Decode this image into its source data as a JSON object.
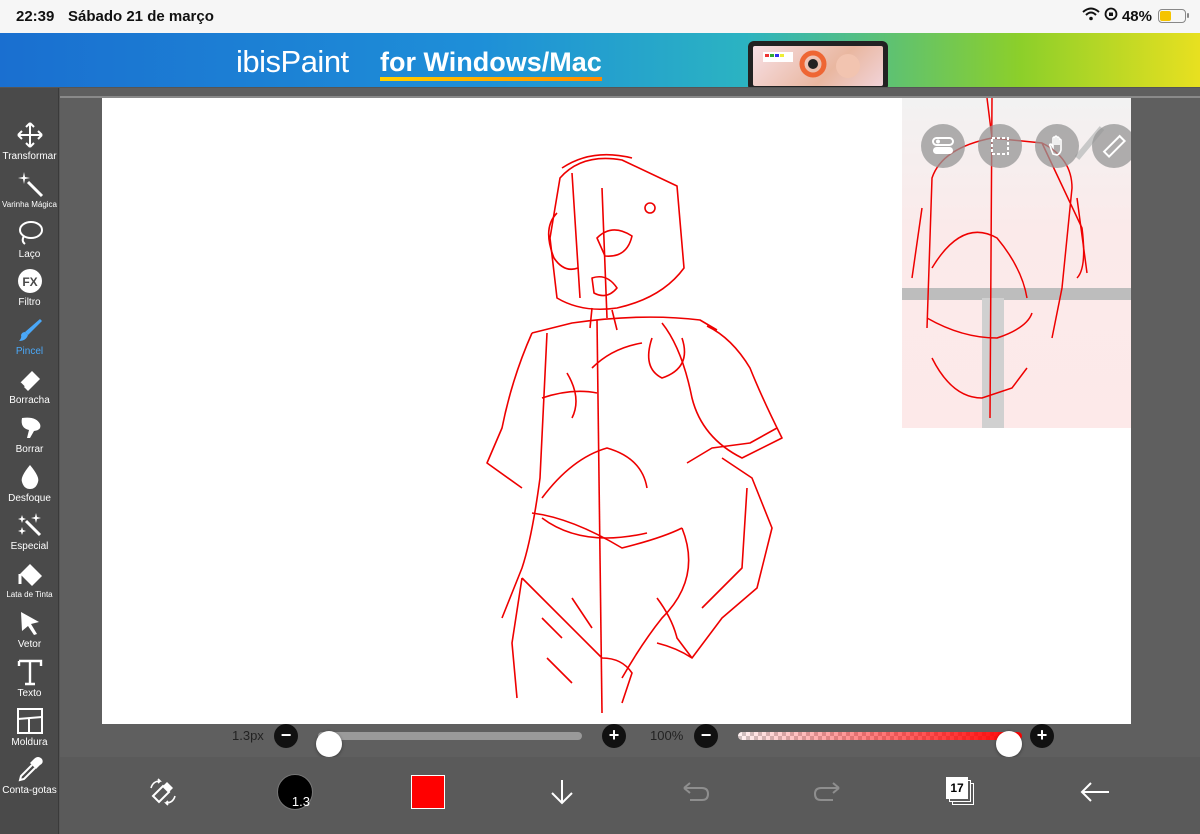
{
  "status_bar": {
    "time": "22:39",
    "date": "Sábado 21 de março",
    "battery": "48%",
    "battery_level": 0.48,
    "icons": [
      "wifi-icon",
      "orientation-lock-icon",
      "battery-icon"
    ]
  },
  "ad_banner": {
    "logo": "ibisPaint",
    "tagline": "for Windows/Mac"
  },
  "tools": [
    {
      "name": "transform",
      "label": "Transformar",
      "icon": "move-arrows-icon"
    },
    {
      "name": "magic-wand",
      "label": "Varinha Mágica",
      "icon": "magic-wand-icon"
    },
    {
      "name": "lasso",
      "label": "Laço",
      "icon": "lasso-icon"
    },
    {
      "name": "filter",
      "label": "Filtro",
      "icon": "fx-icon"
    },
    {
      "name": "brush",
      "label": "Pincel",
      "icon": "brush-icon",
      "active": true
    },
    {
      "name": "eraser",
      "label": "Borracha",
      "icon": "eraser-icon"
    },
    {
      "name": "smudge",
      "label": "Borrar",
      "icon": "smudge-icon"
    },
    {
      "name": "blur",
      "label": "Desfoque",
      "icon": "drop-icon"
    },
    {
      "name": "special",
      "label": "Especial",
      "icon": "sparkle-icon"
    },
    {
      "name": "bucket",
      "label": "Lata de Tinta",
      "icon": "paint-bucket-icon"
    },
    {
      "name": "vector",
      "label": "Vetor",
      "icon": "cursor-arrow-icon"
    },
    {
      "name": "text",
      "label": "Texto",
      "icon": "text-t-icon"
    },
    {
      "name": "frame",
      "label": "Moldura",
      "icon": "frame-icon"
    },
    {
      "name": "eyedropper",
      "label": "Conta-gotas",
      "icon": "eyedropper-icon"
    }
  ],
  "floating_buttons": [
    "toggle-icon",
    "selection-icon",
    "hand-icon",
    "ruler-icon",
    "reference-image-icon"
  ],
  "brush_size": {
    "value": "1.3px",
    "fraction": 0.0
  },
  "brush_opacity": {
    "value": "100%",
    "fraction": 1.0
  },
  "bottom_bar": {
    "brush_size_badge": "1.3",
    "color": "#ff0000",
    "layers_count": "17",
    "icons": [
      "swap-tool-icon",
      "brush-preview-icon",
      "color-swatch-icon",
      "download-arrow-icon",
      "undo-icon",
      "redo-icon",
      "layers-icon",
      "back-arrow-icon"
    ]
  },
  "accent_color": "#4aa8f8"
}
